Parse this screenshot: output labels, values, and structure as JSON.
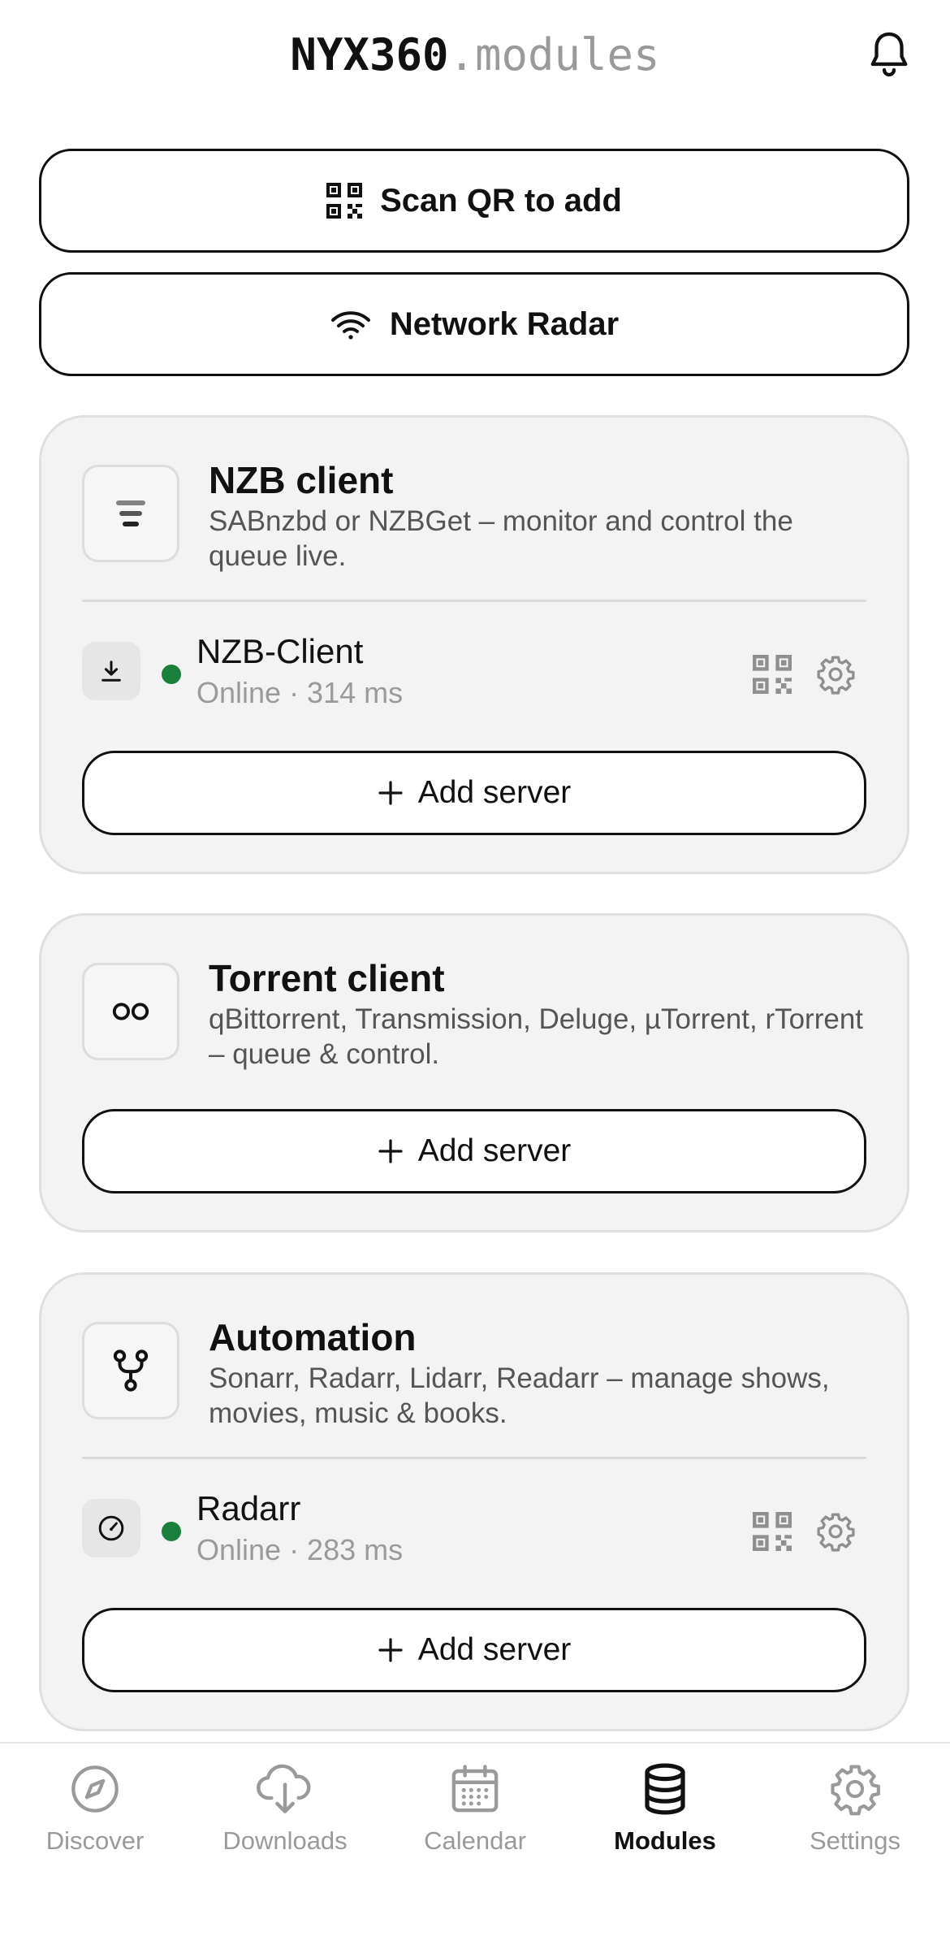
{
  "header": {
    "brand": "NYX360",
    "brand_suffix": ".modules",
    "bell_icon": "bell-icon"
  },
  "actions": {
    "scan_qr_label": "Scan QR to add",
    "network_radar_label": "Network Radar"
  },
  "modules": [
    {
      "title": "NZB client",
      "description": "SABnzbd or NZBGet – monitor and control the queue live.",
      "icon": "stack-icon",
      "servers": [
        {
          "name": "NZB-Client",
          "status": "Online · 314 ms",
          "status_color": "#1a7f3c",
          "icon": "download-icon"
        }
      ],
      "add_label": "Add server"
    },
    {
      "title": "Torrent client",
      "description": "qBittorrent, Transmission, Deluge, µTorrent, rTorrent – queue & control.",
      "icon": "infinity-icon",
      "servers": [],
      "add_label": "Add server"
    },
    {
      "title": "Automation",
      "description": "Sonarr, Radarr, Lidarr, Readarr – manage shows, movies, music & books.",
      "icon": "branch-icon",
      "servers": [
        {
          "name": "Radarr",
          "status": "Online · 283 ms",
          "status_color": "#1a7f3c",
          "icon": "gauge-icon"
        }
      ],
      "add_label": "Add server"
    }
  ],
  "tabbar": {
    "tabs": [
      {
        "label": "Discover",
        "icon": "compass-icon",
        "active": false
      },
      {
        "label": "Downloads",
        "icon": "cloud-download-icon",
        "active": false
      },
      {
        "label": "Calendar",
        "icon": "calendar-icon",
        "active": false
      },
      {
        "label": "Modules",
        "icon": "database-icon",
        "active": true
      },
      {
        "label": "Settings",
        "icon": "gear-icon",
        "active": false
      }
    ]
  },
  "colors": {
    "accent": "#111111",
    "muted": "#9a9a9a",
    "online": "#1a7f3c",
    "card_bg": "#f3f3f3"
  }
}
